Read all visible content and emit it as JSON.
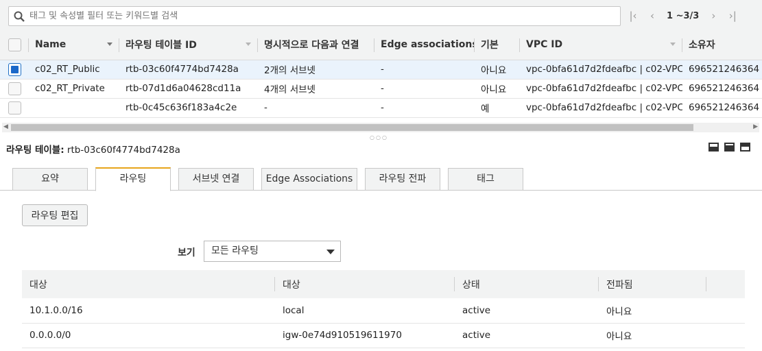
{
  "search": {
    "placeholder": "태그 및 속성별 필터 또는 키워드별 검색"
  },
  "pager": {
    "text": "1 ~3/3"
  },
  "table": {
    "columns": [
      "Name",
      "라우팅 테이블 ID",
      "명시적으로 다음과 연결",
      "Edge associations",
      "기본",
      "VPC ID",
      "소유자"
    ],
    "rows": [
      {
        "selected": true,
        "name": "c02_RT_Public",
        "id": "rtb-03c60f4774bd7428a",
        "subnets": "2개의 서브넷",
        "edge": "-",
        "main": "아니요",
        "vpc": "vpc-0bfa61d7d2fdeafbc | c02-VPC",
        "owner": "696521246364"
      },
      {
        "selected": false,
        "name": "c02_RT_Private",
        "id": "rtb-07d1d6a04628cd11a",
        "subnets": "4개의 서브넷",
        "edge": "-",
        "main": "아니요",
        "vpc": "vpc-0bfa61d7d2fdeafbc | c02-VPC",
        "owner": "696521246364"
      },
      {
        "selected": false,
        "name": "",
        "id": "rtb-0c45c636f183a4c2e",
        "subnets": "-",
        "edge": "-",
        "main": "예",
        "vpc": "vpc-0bfa61d7d2fdeafbc | c02-VPC",
        "owner": "696521246364"
      }
    ]
  },
  "detail": {
    "label": "라우팅 테이블:",
    "value": "rtb-03c60f4774bd7428a"
  },
  "tabs": [
    "요약",
    "라우팅",
    "서브넷 연결",
    "Edge Associations",
    "라우팅 전파",
    "태그"
  ],
  "active_tab": "라우팅",
  "edit_button": "라우팅 편집",
  "view": {
    "label": "보기",
    "selected": "모든 라우팅"
  },
  "routes": {
    "columns": [
      "대상",
      "대상",
      "상태",
      "전파됨"
    ],
    "rows": [
      {
        "destination": "10.1.0.0/16",
        "target": "local",
        "target_is_link": false,
        "status": "active",
        "propagated": "아니요"
      },
      {
        "destination": "0.0.0.0/0",
        "target": "igw-0e74d910519611970",
        "target_is_link": true,
        "status": "active",
        "propagated": "아니요"
      }
    ]
  },
  "colors": {
    "link": "#1a5da8",
    "active": "#1d8102",
    "tab_accent": "#e7a51a",
    "selected_row": "#eaf3fc"
  }
}
